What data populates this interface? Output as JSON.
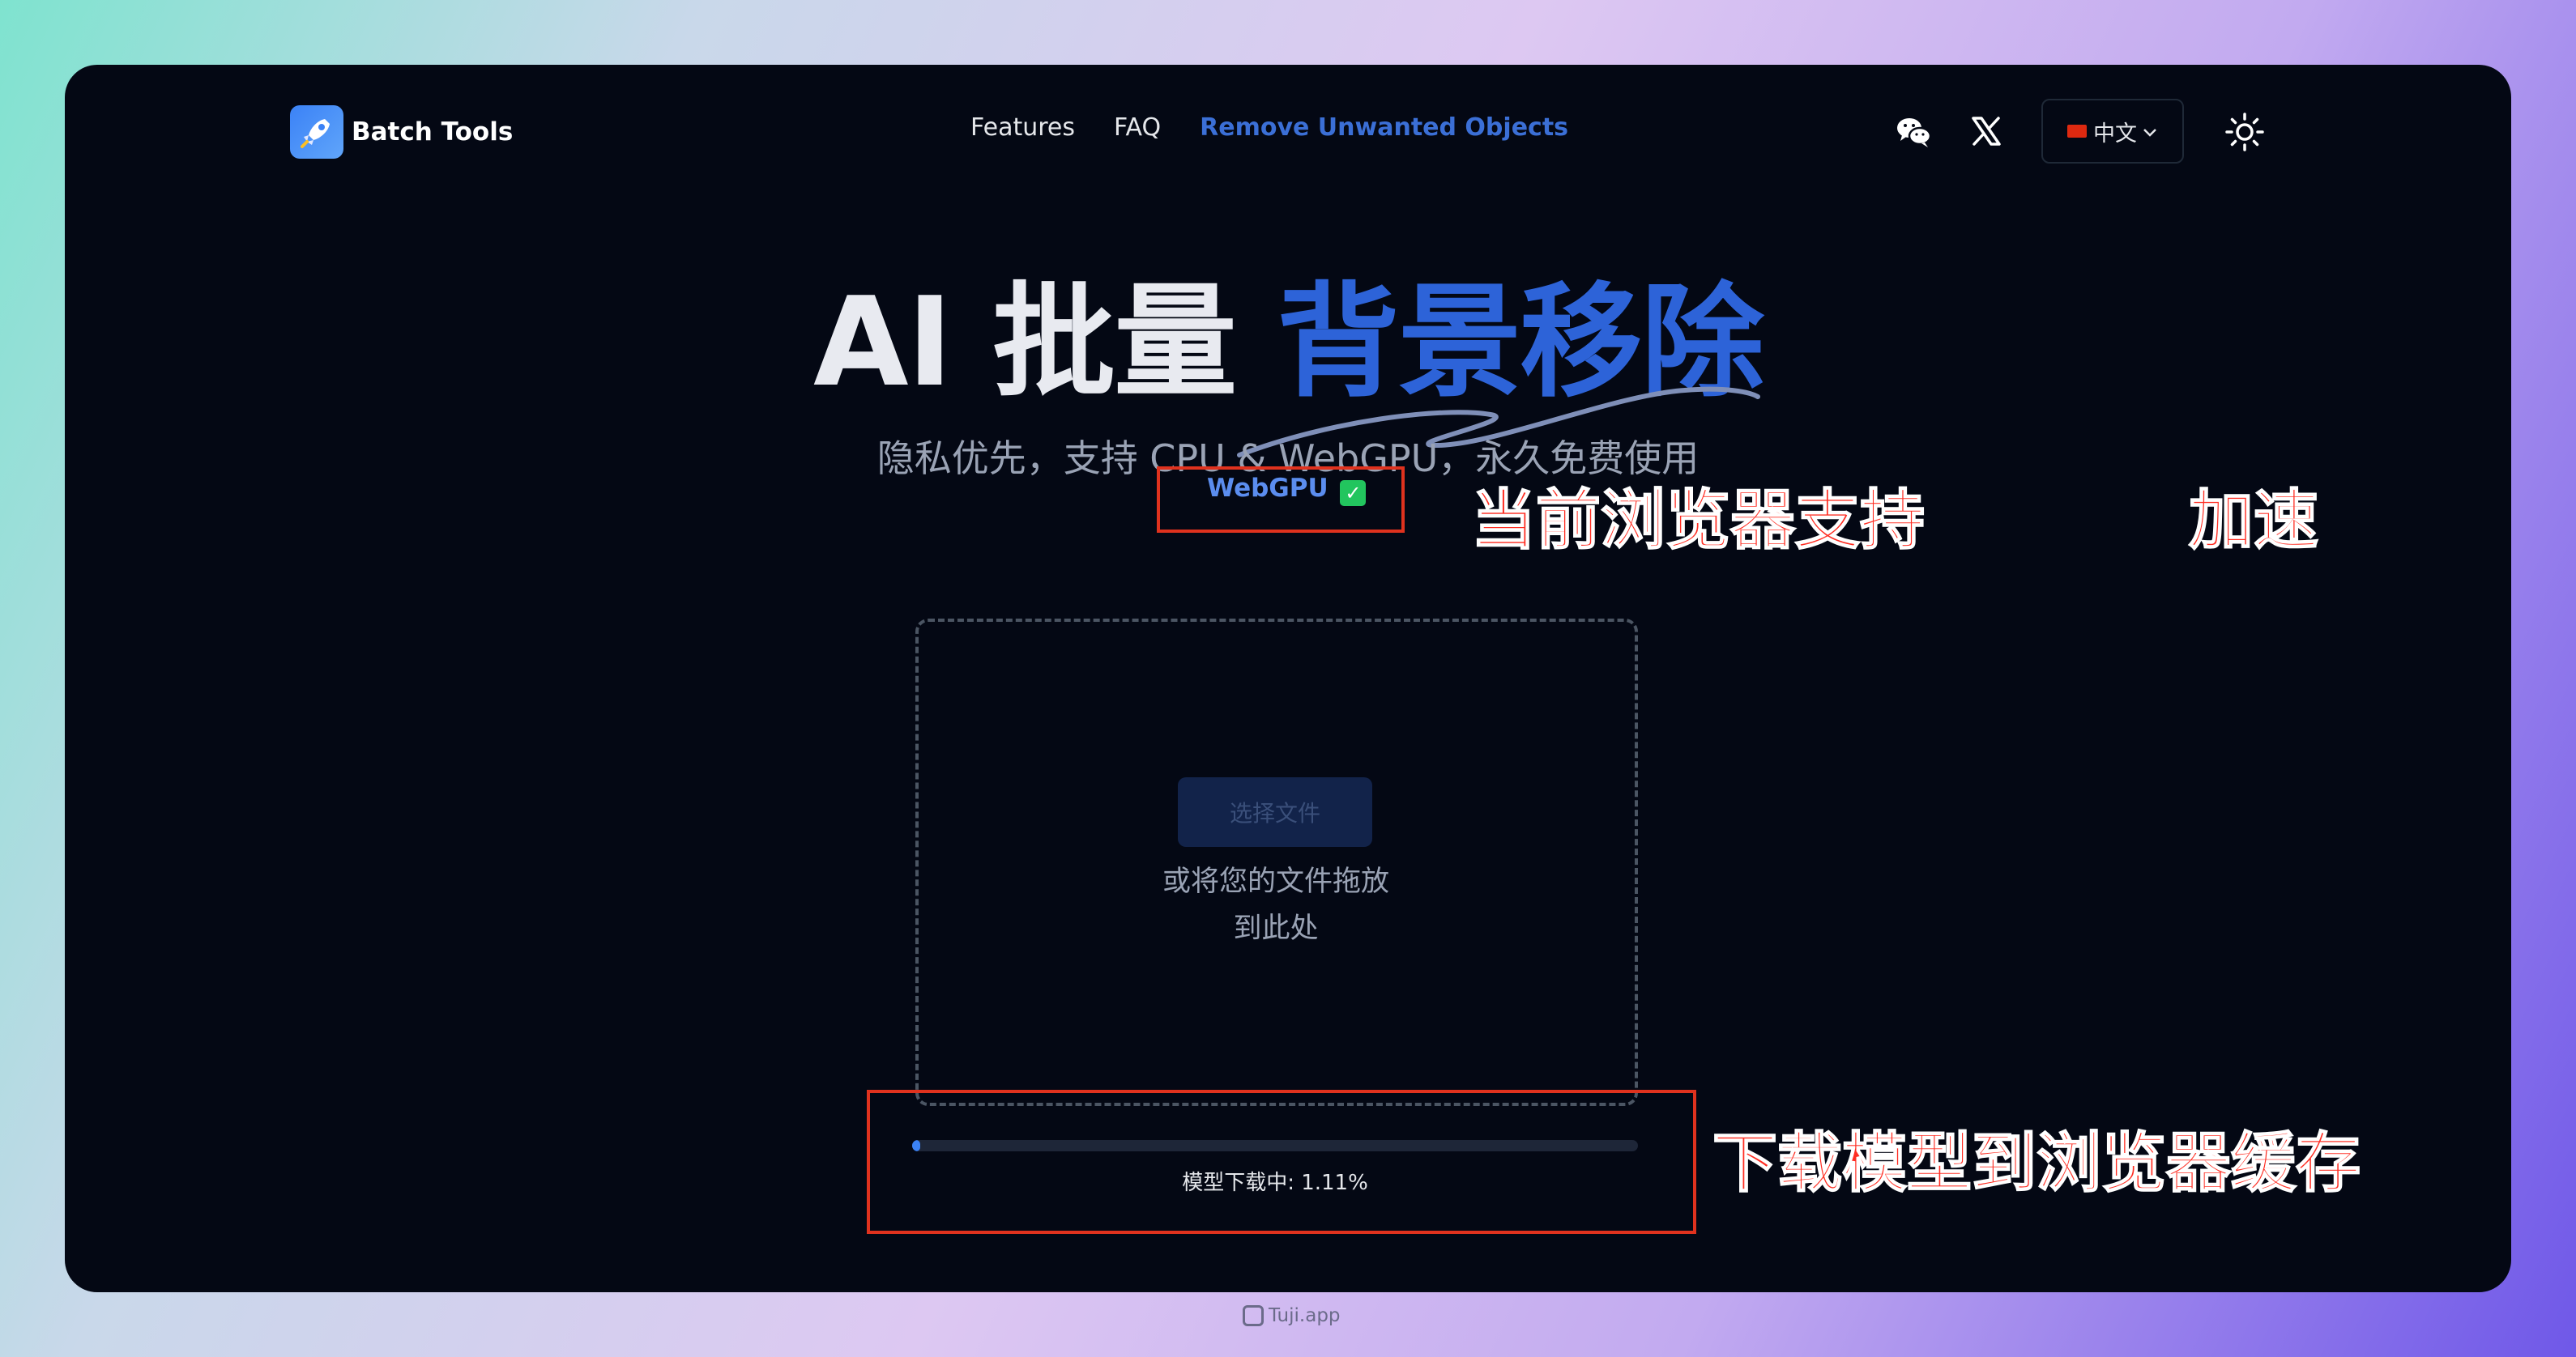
{
  "header": {
    "logo_text": "Batch Tools",
    "nav": [
      "Features",
      "FAQ"
    ],
    "nav_active": "Remove Unwanted Objects",
    "language": "中文",
    "icons": [
      "wechat-icon",
      "x-icon",
      "chevron-down-icon",
      "sun-icon"
    ]
  },
  "hero": {
    "title_part1": "AI 批量",
    "title_part2": "背景移除",
    "subtitle": "隐私优先，支持 CPU & WebGPU，永久免费使用",
    "webgpu_label": "WebGPU",
    "webgpu_check": "✓"
  },
  "dropzone": {
    "button": "选择文件",
    "hint_line1": "或将您的文件拖放",
    "hint_line2": "到此处"
  },
  "progress": {
    "label": "模型下载中: 1.11%",
    "percent": 1.11
  },
  "annotations": {
    "browser_support": "当前浏览器支持",
    "acceleration": "加速",
    "download_cache": "下载模型到浏览器缓存"
  },
  "watermark": "Tuji.app",
  "colors": {
    "background": "#040814",
    "accent": "#2d63d8",
    "annotation": "#e0321e"
  }
}
